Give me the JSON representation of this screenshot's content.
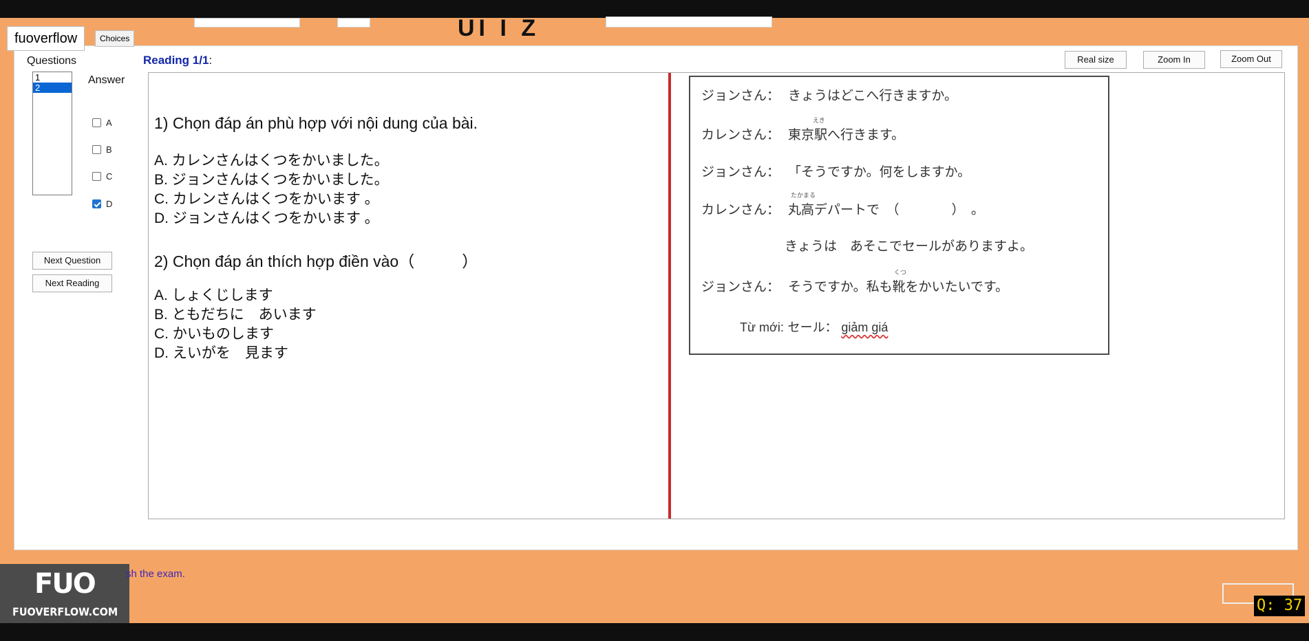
{
  "header": {
    "title_fragment": "UI I Z",
    "tab_multiple": "fuoverflow",
    "tab_choices": "Choices"
  },
  "sidebar": {
    "questions_label": "Questions",
    "questions": [
      "1",
      "2"
    ],
    "selected_question": "2",
    "answer_label": "Answer",
    "options": [
      {
        "label": "A",
        "checked": false
      },
      {
        "label": "B",
        "checked": false
      },
      {
        "label": "C",
        "checked": false
      },
      {
        "label": "D",
        "checked": true
      }
    ],
    "next_question_label": "Next Question",
    "next_reading_label": "Next Reading"
  },
  "main": {
    "reading_label": "Reading 1/1",
    "reading_colon": ":",
    "toolbar": {
      "real_size": "Real size",
      "zoom_in": "Zoom In",
      "zoom_out": "Zoom Out"
    },
    "questions": [
      {
        "text": "1) Chọn đáp án phù hợp với nội dung của bài.",
        "answers": [
          "A.  カレンさんはくつをかいました。",
          "B.  ジョンさんはくつをかいました。",
          "C.  カレンさんはくつをかいます 。",
          "D.  ジョンさんはくつをかいます 。"
        ]
      },
      {
        "text": "2) Chọn đáp án thích hợp điền vào（　　　）",
        "answers": [
          "A.  しょくじします",
          "B.  ともだちに　あいます",
          "C.  かいものします",
          "D.  えいがを　見ます"
        ]
      }
    ],
    "passage": {
      "lines": [
        {
          "speaker": "ジョンさん：",
          "text": "きょうはどこへ行きますか。"
        },
        {
          "speaker": "カレンさん：",
          "text": "東京駅へ行きます。",
          "furigana": "えき"
        },
        {
          "speaker": "ジョンさん：",
          "text": "「そうですか。何をしますか。"
        },
        {
          "speaker": "カレンさん：",
          "text": "丸高デパートで　（　　　　）　。",
          "furigana": "たかまる"
        },
        {
          "speaker": "",
          "text": "きょうは　あそこでセールがありますよ。"
        },
        {
          "speaker": "ジョンさん：",
          "text": "そうですか。私も靴をかいたいです。",
          "furigana": "くつ"
        }
      ],
      "vocab_label": "Từ mới:",
      "vocab_term": "セール：",
      "vocab_meaning": "giảm giá"
    }
  },
  "footer": {
    "finish_text": "sh the exam.",
    "finish_checked": true,
    "watermark_logo": "FUO",
    "watermark_site": "FUOVERFLOW.COM",
    "q_counter": "Q: 37"
  }
}
